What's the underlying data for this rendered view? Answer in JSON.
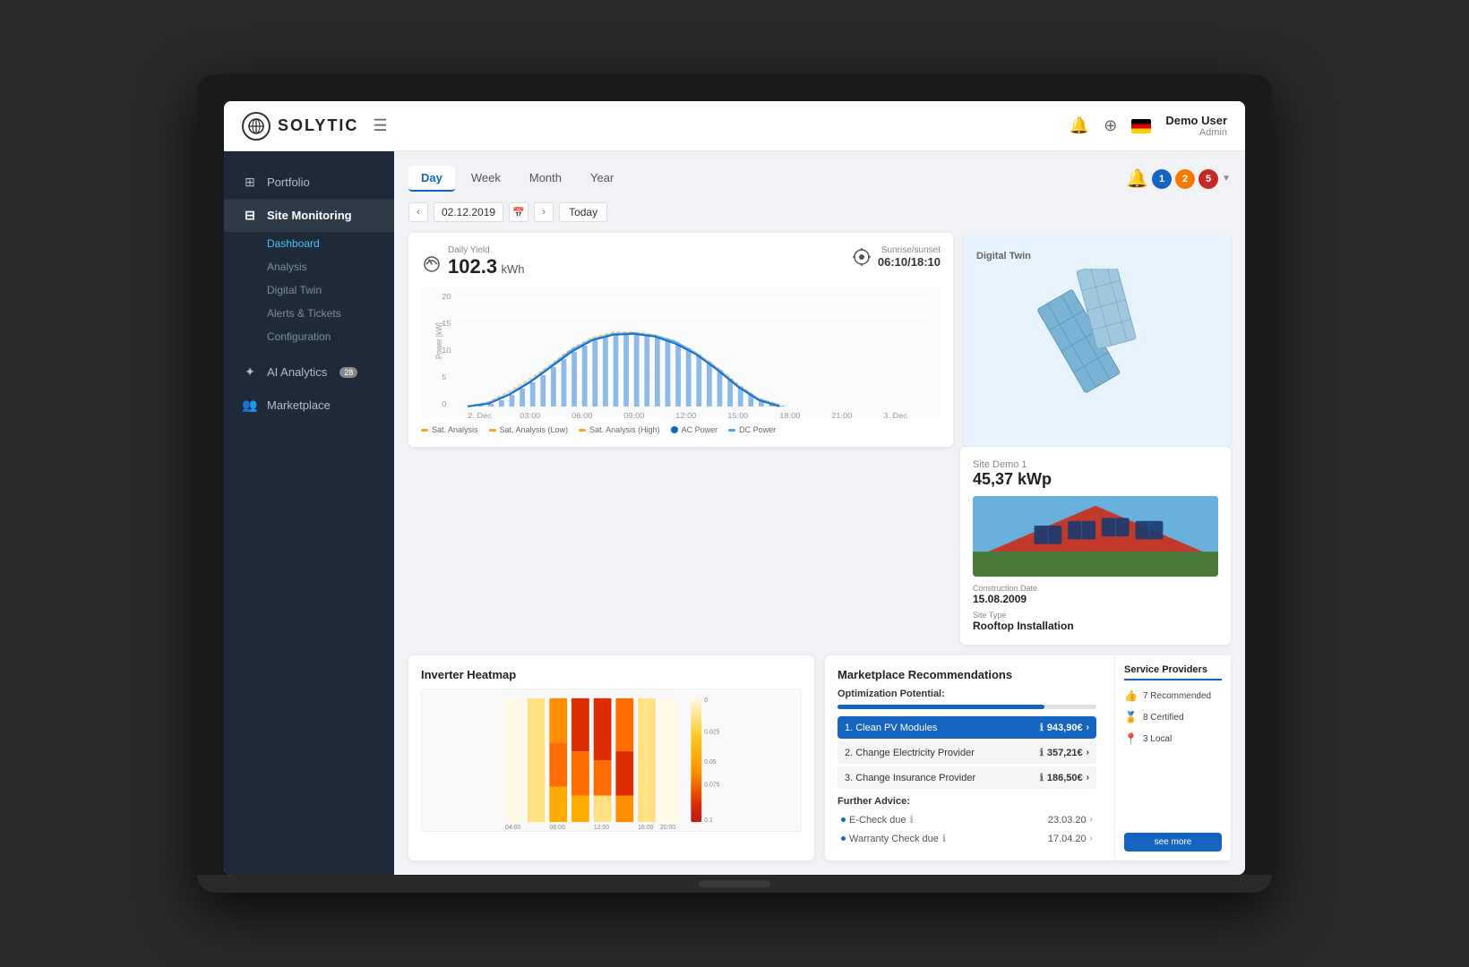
{
  "app": {
    "logo_text": "SOLYTIC",
    "user_name": "Demo User",
    "user_role": "Admin"
  },
  "sidebar": {
    "portfolio_label": "Portfolio",
    "site_monitoring_label": "Site Monitoring",
    "dashboard_label": "Dashboard",
    "analysis_label": "Analysis",
    "digital_twin_label": "Digital Twin",
    "alerts_label": "Alerts & Tickets",
    "configuration_label": "Configuration",
    "ai_analytics_label": "AI Analytics",
    "ai_analytics_badge": "28",
    "marketplace_label": "Marketplace"
  },
  "dashboard": {
    "tabs": [
      "Day",
      "Week",
      "Month",
      "Year"
    ],
    "active_tab": "Day",
    "date": "02.12.2019",
    "today_btn": "Today",
    "daily_yield_label": "Daily Yield",
    "daily_yield_value": "102.3",
    "daily_yield_unit": "kWh",
    "sunrise_label": "Sunrise/sunset",
    "sunrise_value": "06:10/18:10",
    "digital_twin_label": "Digital Twin",
    "site_label": "Site Demo 1",
    "site_power": "45,37 kWp",
    "construction_date_label": "Construction Date",
    "construction_date": "15.08.2009",
    "site_type_label": "Site Type",
    "site_type": "Rooftop Installation",
    "inverter_heatmap_label": "Inverter Heatmap",
    "marketplace_recommendations_label": "Marketplace Recommendations",
    "optimization_potential_label": "Optimization Potential:",
    "market_items": [
      {
        "label": "1. Clean PV Modules",
        "value": "943,90€",
        "highlighted": true
      },
      {
        "label": "2. Change Electricity Provider",
        "value": "357,21€",
        "highlighted": false
      },
      {
        "label": "3. Change Insurance Provider",
        "value": "186,50€",
        "highlighted": false
      }
    ],
    "further_advice_label": "Further Advice:",
    "further_items": [
      {
        "label": "E-Check due",
        "date": "23.03.20"
      },
      {
        "label": "Warranty Check due",
        "date": "17.04.20"
      }
    ],
    "service_providers_label": "Service Providers",
    "recommended_label": "7 Recommended",
    "certified_label": "8 Certified",
    "local_label": "3 Local",
    "see_more_label": "see more",
    "legend": [
      {
        "label": "Sat. Analysis",
        "color": "#f5a623"
      },
      {
        "label": "Sat. Analysis (Low)",
        "color": "#f5a623"
      },
      {
        "label": "Sat. Analysis (High)",
        "color": "#f5a623"
      },
      {
        "label": "AC Power",
        "color": "#1565c0"
      },
      {
        "label": "DC Power",
        "color": "#42a5f5"
      }
    ],
    "notification_badges": [
      "1",
      "2",
      "5"
    ]
  }
}
